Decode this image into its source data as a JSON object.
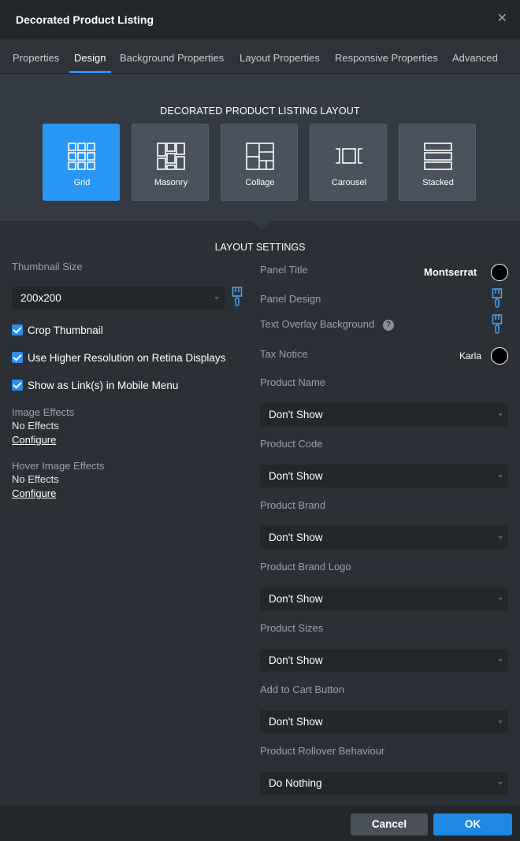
{
  "dialog": {
    "title": "Decorated Product Listing"
  },
  "tabs": [
    {
      "label": "Properties"
    },
    {
      "label": "Design"
    },
    {
      "label": "Background Properties"
    },
    {
      "label": "Layout Properties"
    },
    {
      "label": "Responsive Properties"
    },
    {
      "label": "Advanced"
    }
  ],
  "active_tab": "Design",
  "layout": {
    "heading": "DECORATED PRODUCT LISTING LAYOUT",
    "options": [
      {
        "label": "Grid",
        "icon": "grid-icon"
      },
      {
        "label": "Masonry",
        "icon": "masonry-icon"
      },
      {
        "label": "Collage",
        "icon": "collage-icon"
      },
      {
        "label": "Carousel",
        "icon": "carousel-icon"
      },
      {
        "label": "Stacked",
        "icon": "stacked-icon"
      }
    ],
    "selected": "Grid"
  },
  "settings": {
    "heading": "LAYOUT SETTINGS",
    "thumbnail_size": {
      "label": "Thumbnail Size",
      "value": "200x200"
    },
    "checkboxes": [
      {
        "label": "Crop Thumbnail",
        "checked": true
      },
      {
        "label": "Use Higher Resolution on Retina Displays",
        "checked": true
      },
      {
        "label": "Show as Link(s) in Mobile Menu",
        "checked": true
      }
    ],
    "image_effects": {
      "label": "Image Effects",
      "value": "No Effects",
      "link": "Configure"
    },
    "hover_image_effects": {
      "label": "Hover Image Effects",
      "value": "No Effects",
      "link": "Configure"
    },
    "panel_title": {
      "label": "Panel Title",
      "font": "Montserrat",
      "color": "#000000"
    },
    "panel_design": {
      "label": "Panel Design"
    },
    "text_overlay_background": {
      "label": "Text Overlay Background",
      "help": "?"
    },
    "tax_notice": {
      "label": "Tax Notice",
      "font": "Karla",
      "color": "#000000"
    },
    "product_name": {
      "label": "Product Name",
      "value": "Don't Show"
    },
    "product_code": {
      "label": "Product Code",
      "value": "Don't Show"
    },
    "product_brand": {
      "label": "Product Brand",
      "value": "Don't Show"
    },
    "product_brand_logo": {
      "label": "Product Brand Logo",
      "value": "Don't Show"
    },
    "product_sizes": {
      "label": "Product Sizes",
      "value": "Don't Show"
    },
    "add_to_cart": {
      "label": "Add to Cart Button",
      "value": "Don't Show"
    },
    "rollover": {
      "label": "Product Rollover Behaviour",
      "value": "Do Nothing"
    }
  },
  "footer": {
    "cancel": "Cancel",
    "ok": "OK"
  },
  "colors": {
    "accent": "#2b8ff0",
    "tile_active": "#2b97f5",
    "ok_button": "#1e88e5"
  }
}
